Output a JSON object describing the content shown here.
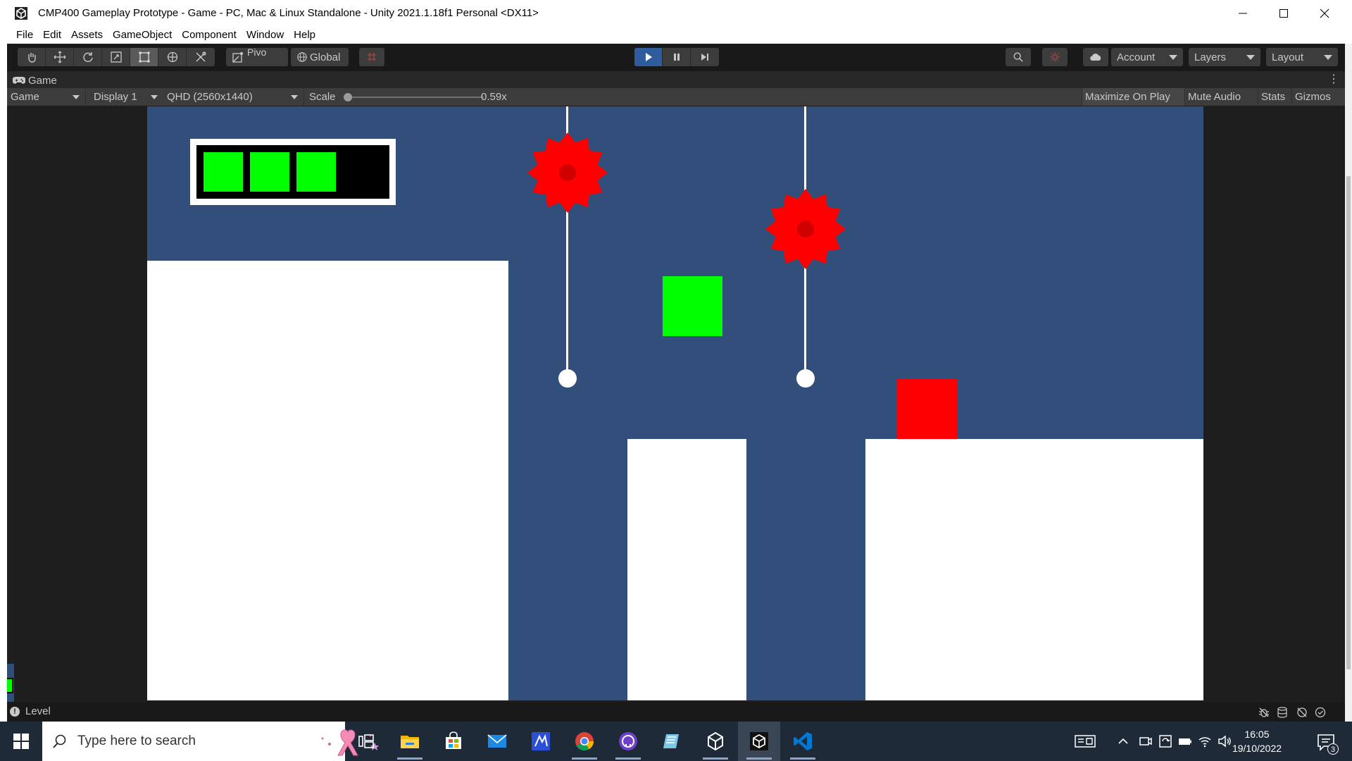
{
  "window": {
    "title": "CMP400 Gameplay Prototype - Game - PC, Mac & Linux Standalone - Unity 2021.1.18f1 Personal <DX11>",
    "icon": "unity-icon",
    "controls": [
      "minimize-icon",
      "maximize-icon",
      "close-icon"
    ]
  },
  "menu": {
    "items": [
      "File",
      "Edit",
      "Assets",
      "GameObject",
      "Component",
      "Window",
      "Help"
    ]
  },
  "toolbar": {
    "tools": [
      "hand-icon",
      "move-icon",
      "rotate-icon",
      "scale-icon",
      "rect-icon",
      "transform-icon",
      "custom-tool-icon"
    ],
    "active_tool": "rect-icon",
    "pivot_label": "Pivo",
    "global_label": "Global",
    "snap_icon": "grid-snap-icon",
    "playback": [
      "play-icon",
      "pause-icon",
      "step-icon"
    ],
    "play_active": true,
    "account_label": "Account",
    "layers_label": "Layers",
    "layout_label": "Layout"
  },
  "game_tab": {
    "label": "Game",
    "icon": "gamepad-icon"
  },
  "game_controls": {
    "view_mode": "Game",
    "display": "Display 1",
    "resolution": "QHD (2560x1440)",
    "scale_label": "Scale",
    "scale_value": "0.59x",
    "maximize_on_play": "Maximize On Play",
    "mute_audio": "Mute Audio",
    "stats": "Stats",
    "gizmos": "Gizmos"
  },
  "game_scene": {
    "background_color": "#324f7b",
    "health": {
      "filled_segments": 3,
      "total_segments": 4,
      "segment_color": "#00ff00"
    },
    "player_color": "#00ff00",
    "enemy_color": "#ff0000",
    "hazard_color": "#ff0000",
    "platform_color": "#ffffff"
  },
  "status_bar": {
    "label": "Level"
  },
  "taskbar": {
    "search_placeholder": "Type here to search",
    "apps": [
      "task-view-icon",
      "file-explorer-icon",
      "microsoft-store-icon",
      "mail-icon",
      "unity-hub-icon",
      "chrome-icon",
      "github-desktop-icon",
      "notes-app-icon",
      "unity-icon",
      "unity-editor-icon",
      "vscode-icon"
    ],
    "time": "16:05",
    "date": "19/10/2022",
    "notification_count": "3"
  }
}
